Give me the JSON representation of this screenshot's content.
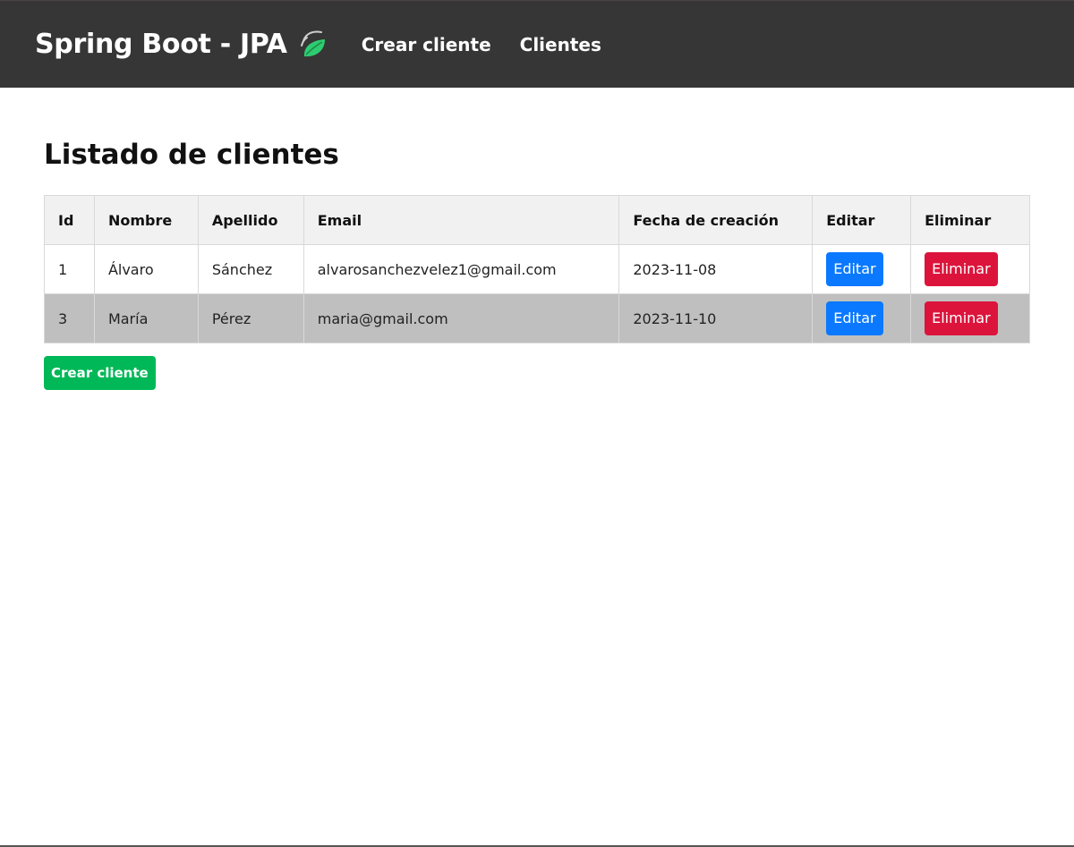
{
  "navbar": {
    "brand": "Spring Boot - JPA",
    "logo_icon": "spring-leaf-icon",
    "links": [
      "Crear cliente",
      "Clientes"
    ],
    "background": "#363636"
  },
  "main": {
    "title": "Listado de clientes",
    "table": {
      "headers": [
        "Id",
        "Nombre",
        "Apellido",
        "Email",
        "Fecha de creación",
        "Editar",
        "Eliminar"
      ],
      "rows": [
        {
          "id": "1",
          "nombre": "Álvaro",
          "apellido": "Sánchez",
          "email": "alvarosanchezvelez1@gmail.com",
          "fecha": "2023-11-08",
          "edit_label": "Editar",
          "delete_label": "Eliminar"
        },
        {
          "id": "3",
          "nombre": "María",
          "apellido": "Pérez",
          "email": "maria@gmail.com",
          "fecha": "2023-11-10",
          "edit_label": "Editar",
          "delete_label": "Eliminar"
        }
      ]
    },
    "create_button": "Crear cliente"
  },
  "colors": {
    "edit": "#0a79ff",
    "delete": "#dc143c",
    "create": "#00b857",
    "even_row": "#bfbfbf",
    "header_row": "#f1f1f1"
  }
}
